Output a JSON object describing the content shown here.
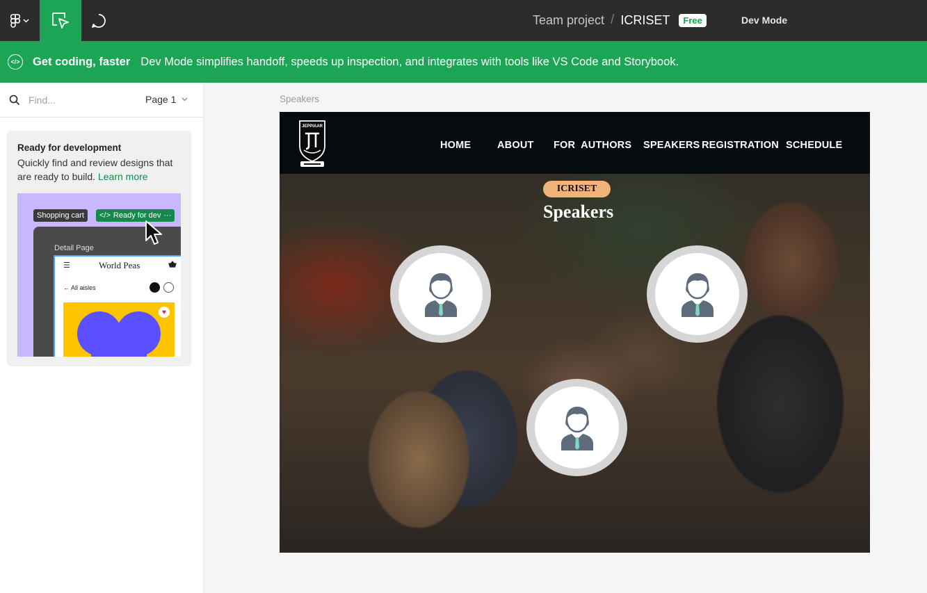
{
  "topbar": {
    "breadcrumb_team": "Team project",
    "breadcrumb_sep": "/",
    "file_name": "ICRISET",
    "plan_badge": "Free",
    "mode_label": "Dev Mode",
    "icons": [
      "figma-logo-icon",
      "chevron-down-icon",
      "move-tool-icon",
      "comment-icon"
    ]
  },
  "banner": {
    "icon": "code-icon",
    "headline": "Get coding, faster",
    "text": "Dev Mode simplifies handoff, speeds up inspection, and integrates with tools like VS Code and Storybook."
  },
  "left_panel": {
    "search": {
      "placeholder": "Find...",
      "value": ""
    },
    "page_selector": {
      "value": "Page 1"
    },
    "ready_card": {
      "title": "Ready for development",
      "description": "Quickly find and review designs that are ready to build.",
      "link": "Learn more",
      "preview": {
        "tag_cart": "Shopping cart",
        "tag_ready": "Ready for dev",
        "tag_more": "···",
        "detail_label": "Detail Page",
        "menu_glyph": "☰",
        "brand": "World Peas",
        "aisles_link": "← All aisles"
      }
    }
  },
  "canvas": {
    "frame_label": "Speakers",
    "site": {
      "logo_text": "JEPPIAAR",
      "nav": [
        "HOME",
        "ABOUT",
        "FOR  AUTHORS",
        "SPEAKERS",
        "REGISTRATION",
        "SCHEDULE"
      ],
      "pill": "ICRISET",
      "title": "Speakers",
      "speakers": [
        "speaker-1",
        "speaker-2",
        "speaker-3"
      ]
    }
  },
  "colors": {
    "topbar_bg": "#2c2c2c",
    "accent_green": "#1ba555",
    "nav_bg": "#060b0d",
    "pill": "#f2b37a",
    "preview_purple": "#c9b8ff",
    "preview_yellow": "#ffc400",
    "blob_blue": "#5b50ff"
  }
}
